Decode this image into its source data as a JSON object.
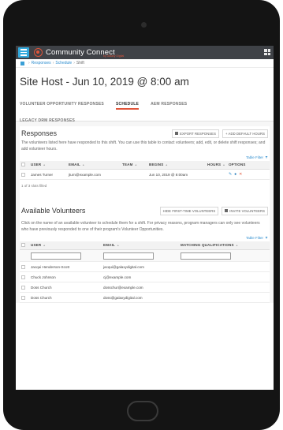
{
  "app": {
    "brand": "Community Connect",
    "brand_sub": "by Galaxy Digital"
  },
  "breadcrumb": {
    "items": [
      "Responses",
      "Schedule",
      "Shift"
    ],
    "separator": "›"
  },
  "page": {
    "title": "Site Host - Jun 10, 2019 @ 8:00 am"
  },
  "tabs": [
    {
      "label": "VOLUNTEER OPPORTUNITY RESPONSES",
      "active": false
    },
    {
      "label": "SCHEDULE",
      "active": true
    },
    {
      "label": "AEM RESPONSES",
      "active": false
    },
    {
      "label": "LEGACY DRM RESPONSES",
      "active": false
    }
  ],
  "responses": {
    "title": "Responses",
    "export_label": "EXPORT RESPONSES",
    "add_hours_label": "+ ADD DEFAULT HOURS",
    "description": "The volunteers listed here have responded to this shift. You can use this table to contact volunteers; add, edit, or delete shift responses; and add volunteer hours.",
    "filter_label": "Table Filter",
    "columns": [
      "USER",
      "EMAIL",
      "TEAM",
      "BEGINS",
      "HOURS",
      "OPTIONS"
    ],
    "rows": [
      {
        "user": "James Turner",
        "email": "jturn@example.com",
        "team": "",
        "begins": "Jun 10, 2019 @ 8:00am",
        "hours": ""
      }
    ],
    "footnote": "1 of 3 slots filled"
  },
  "available": {
    "title": "Available Volunteers",
    "hide_label": "HIDE FIRST-TIME VOLUNTEERS",
    "invite_label": "INVITE VOLUNTEERS",
    "description": "Click on the name of an available volunteer to schedule them for a shift. For privacy reasons, program managers can only see volunteers who have previously responded to one of their program's Volunteer Opportunities.",
    "filter_label": "Table Filter",
    "columns": [
      "USER",
      "EMAIL",
      "MATCHING QUALIFICATIONS"
    ],
    "rows": [
      {
        "user": "Jacqui Henderson-Scott",
        "email": "jacqui@galaxydigital.com"
      },
      {
        "user": "Chuck Johnson",
        "email": "cj@example.com"
      },
      {
        "user": "Doss Church",
        "email": "dosschur@example.com"
      },
      {
        "user": "Doss Church",
        "email": "doss@galaxydigital.com"
      }
    ]
  },
  "colors": {
    "accent": "#e0553a",
    "link": "#2f8ecf",
    "appbar": "#3f4247",
    "menu": "#33a9dc"
  }
}
